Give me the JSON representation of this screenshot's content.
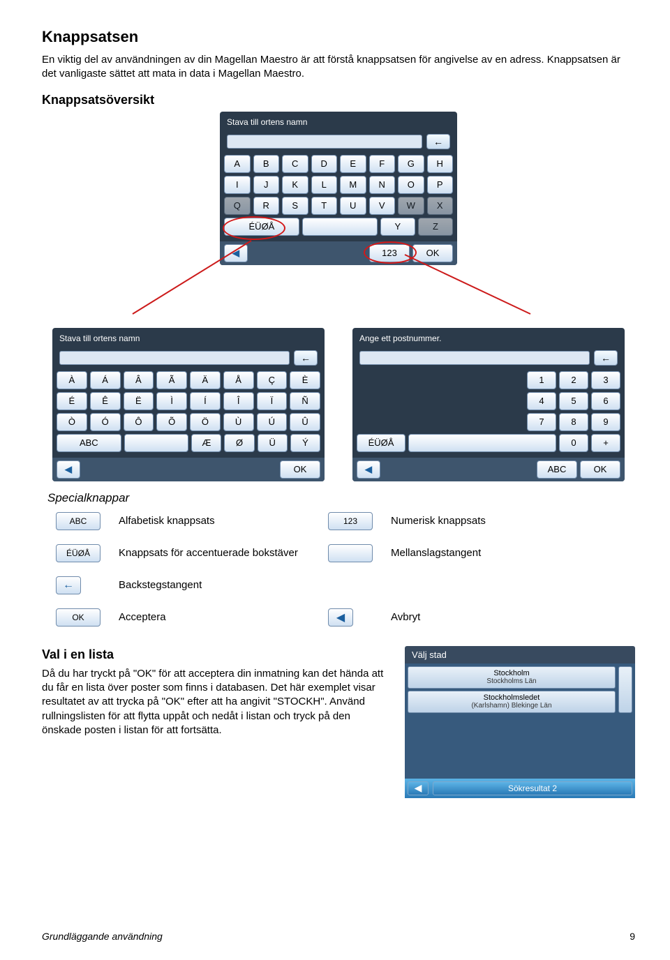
{
  "heading": "Knappsatsen",
  "intro": "En viktig del av användningen av din Magellan Maestro är att förstå knappsatsen för angivelse av en adress. Knappsatsen är det vanligaste sättet att mata in data i Magellan Maestro.",
  "overview_heading": "Knappsatsöversikt",
  "kb_main": {
    "title": "Stava till ortens namn",
    "rows": [
      [
        "A",
        "B",
        "C",
        "D",
        "E",
        "F",
        "G",
        "H"
      ],
      [
        "I",
        "J",
        "K",
        "L",
        "M",
        "N",
        "O",
        "P"
      ],
      [
        "Q",
        "R",
        "S",
        "T",
        "U",
        "V",
        "W",
        "X"
      ]
    ],
    "row4": {
      "special": "ÉÜØÅ",
      "y": "Y",
      "z": "Z"
    },
    "bottom": {
      "num": "123",
      "ok": "OK"
    }
  },
  "kb_left": {
    "title": "Stava till ortens namn",
    "rows": [
      [
        "À",
        "Á",
        "Â",
        "Ã",
        "Ä",
        "Å",
        "Ç",
        "È"
      ],
      [
        "É",
        "Ê",
        "Ë",
        "Ì",
        "Í",
        "Î",
        "Ï",
        "Ñ"
      ],
      [
        "Ò",
        "Ó",
        "Ô",
        "Õ",
        "Ö",
        "Ù",
        "Ú",
        "Û"
      ]
    ],
    "row4": {
      "abc": "ABC",
      "ae": "Æ",
      "oslash": "Ø",
      "u": "Ü",
      "y": "Ý"
    },
    "bottom": {
      "ok": "OK"
    }
  },
  "kb_right": {
    "title": "Ange ett postnummer.",
    "rows": [
      [
        "1",
        "2",
        "3"
      ],
      [
        "4",
        "5",
        "6"
      ],
      [
        "7",
        "8",
        "9"
      ]
    ],
    "row4": {
      "special": "ÉÜØÅ",
      "zero": "0",
      "plus": "+"
    },
    "bottom": {
      "abc": "ABC",
      "ok": "OK"
    }
  },
  "special_heading": "Specialknappar",
  "special": {
    "abc_key": "ABC",
    "abc_label": "Alfabetisk knappsats",
    "num_key": "123",
    "num_label": "Numerisk knappsats",
    "accent_key": "ÉÜØÅ",
    "accent_label": "Knappsats för accentuerade bokstäver",
    "space_label": "Mellanslagstangent",
    "back_glyph": "←",
    "back_label": "Backstegstangent",
    "ok_key": "OK",
    "ok_label": "Acceptera",
    "cancel_glyph": "◀",
    "cancel_label": "Avbryt"
  },
  "list": {
    "heading": "Val i en lista",
    "text": "Då du har tryckt på \"OK\" för att acceptera din inmatning kan det hända att du får en lista över poster som finns i databasen. Det här exemplet visar resultatet av att trycka på \"OK\" efter att ha angivit \"STOCKH\". Använd rullningslisten för att flytta uppåt och nedåt i listan och tryck på den önskade posten i listan för att fortsätta.",
    "panel_title": "Välj stad",
    "items": [
      {
        "name": "Stockholm",
        "sub": "Stockholms Län"
      },
      {
        "name": "Stockholmsledet",
        "sub": "(Karlshamn) Blekinge Län"
      }
    ],
    "result_label": "Sökresultat 2",
    "back_glyph": "◀"
  },
  "footer": {
    "left": "Grundläggande användning",
    "right": "9"
  }
}
